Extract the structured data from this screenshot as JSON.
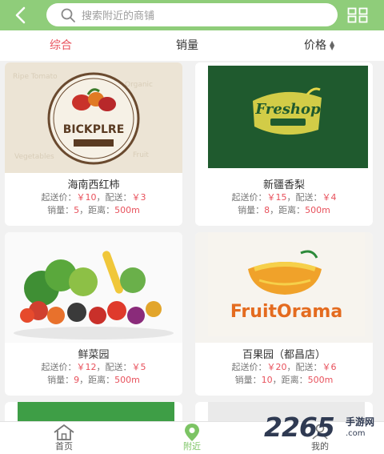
{
  "search": {
    "placeholder": "搜索附近的商铺"
  },
  "sort": {
    "items": [
      "综合",
      "销量",
      "价格"
    ]
  },
  "cards": [
    {
      "name": "海南西红柿",
      "min_price_label": "起送价：",
      "min_price": "￥10",
      "fee_label": "，配送：",
      "fee": "￥3",
      "sales_label": "销量：",
      "sales": "5",
      "dist_label": "，距离：",
      "dist": "500m",
      "img_text": "BICKPLRE"
    },
    {
      "name": "新疆香梨",
      "min_price_label": "起送价：",
      "min_price": "￥15",
      "fee_label": "，配送：",
      "fee": "￥4",
      "sales_label": "销量：",
      "sales": "8",
      "dist_label": "，距离：",
      "dist": "500m",
      "img_text": "Freshop"
    },
    {
      "name": "鲜菜园",
      "min_price_label": "起送价：",
      "min_price": "￥12",
      "fee_label": "，配送：",
      "fee": "￥5",
      "sales_label": "销量：",
      "sales": "9",
      "dist_label": "，距离：",
      "dist": "500m",
      "img_text": ""
    },
    {
      "name": "百果园（都昌店）",
      "min_price_label": "起送价：",
      "min_price": "￥20",
      "fee_label": "，配送：",
      "fee": "￥6",
      "sales_label": "销量：",
      "sales": "10",
      "dist_label": "，距离：",
      "dist": "500m",
      "img_text": "FruitOrama"
    }
  ],
  "tabbar": {
    "items": [
      {
        "label": "首页",
        "icon": "home-icon"
      },
      {
        "label": "附近",
        "icon": "location-pin-icon"
      },
      {
        "label": "我的",
        "icon": "user-icon"
      }
    ]
  },
  "watermark": {
    "number": "2265",
    "domain": ".com",
    "name": "手游网"
  },
  "colors": {
    "brand_green": "#8fcd7a",
    "accent_red": "#e8515c",
    "tab_active": "#7cc464"
  }
}
